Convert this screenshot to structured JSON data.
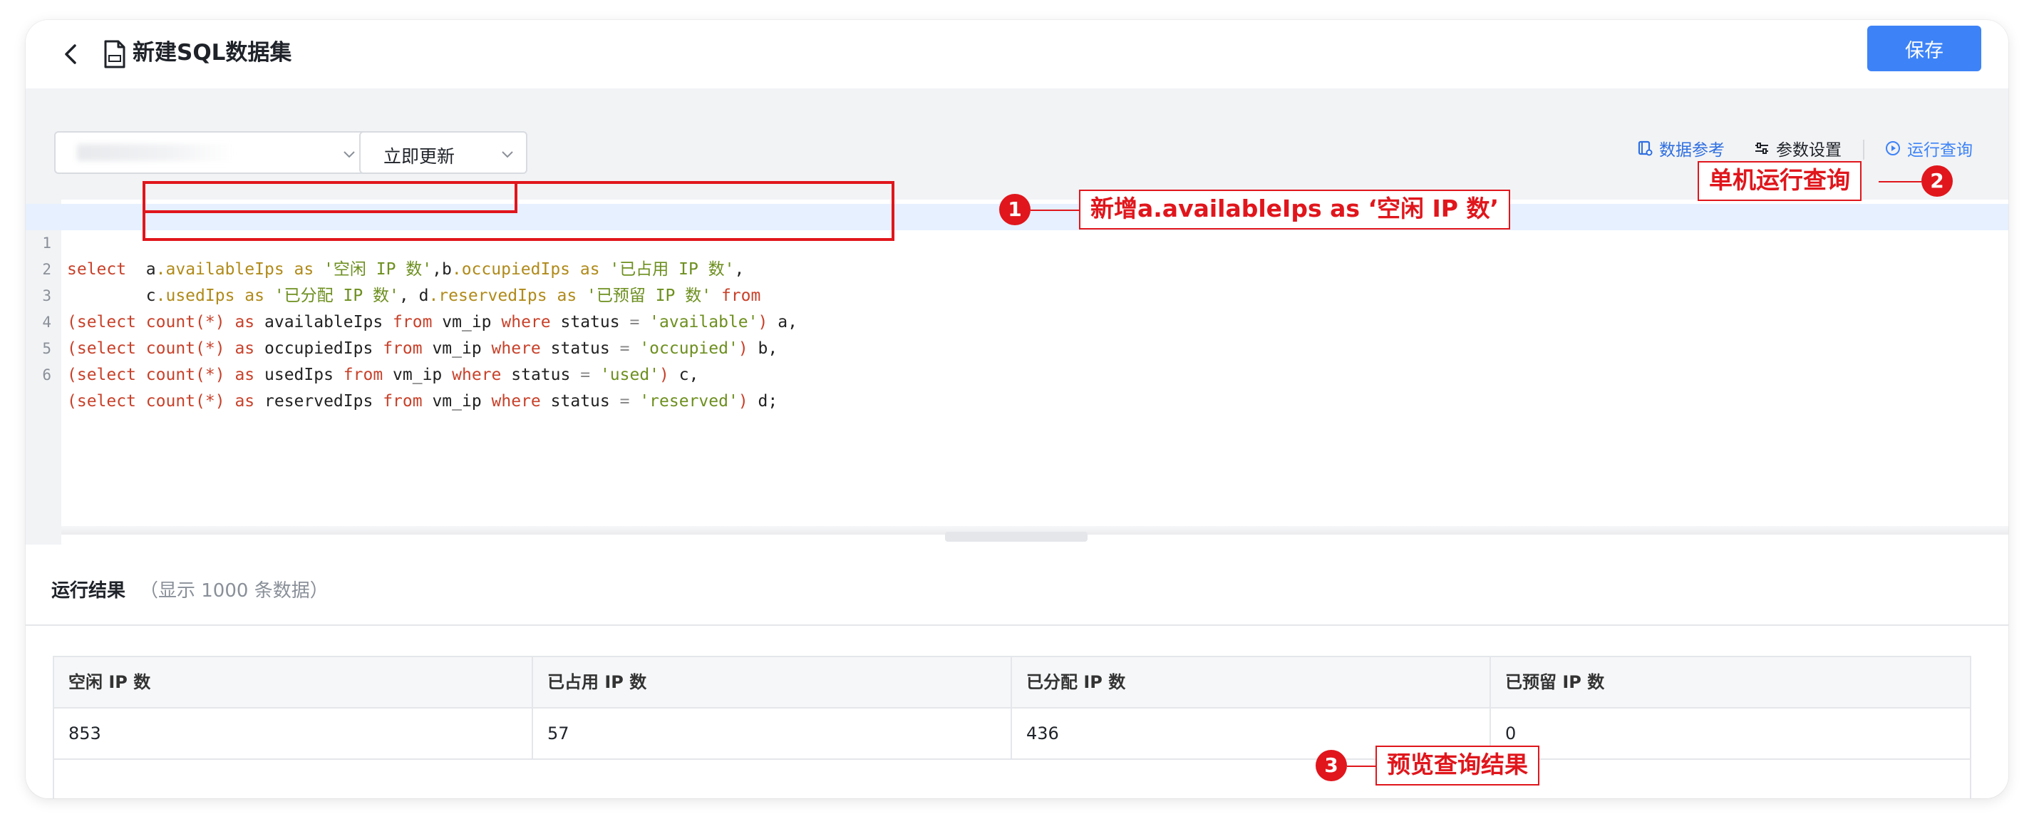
{
  "header": {
    "title": "新建SQL数据集",
    "save_label": "保存"
  },
  "toolbar": {
    "refresh_select": "立即更新",
    "actions": {
      "data_reference": "数据参考",
      "param_settings": "参数设置",
      "run_query": "运行查询"
    }
  },
  "editor": {
    "line_numbers": [
      "1",
      "2",
      "3",
      "4",
      "5",
      "6"
    ],
    "lines": [
      "select  a.availableIps as '空闲 IP 数',b.occupiedIps as '已占用 IP 数',",
      "        c.usedIps as '已分配 IP 数', d.reservedIps as '已预留 IP 数' from",
      "(select count(*) as availableIps from vm_ip where status = 'available') a,",
      "(select count(*) as occupiedIps from vm_ip where status = 'occupied') b,",
      "(select count(*) as usedIps from vm_ip where status = 'used') c,",
      "(select count(*) as reservedIps from vm_ip where status = 'reserved') d;"
    ]
  },
  "annotations": {
    "a1": {
      "number": "1",
      "label": "新增a.availableIps as ‘空闲 IP 数’"
    },
    "a2": {
      "number": "2",
      "label": "单机运行查询"
    },
    "a3": {
      "number": "3",
      "label": "预览查询结果"
    }
  },
  "results": {
    "title": "运行结果",
    "note": "（显示 1000 条数据）",
    "columns": [
      "空闲 IP 数",
      "已占用 IP 数",
      "已分配 IP 数",
      "已预留 IP 数"
    ],
    "rows": [
      [
        "853",
        "57",
        "436",
        "0"
      ]
    ]
  },
  "colors": {
    "primary": "#3d83f7",
    "annotation_red": "#e0161c",
    "keyword": "#c8412a",
    "string": "#6d8f1f"
  }
}
